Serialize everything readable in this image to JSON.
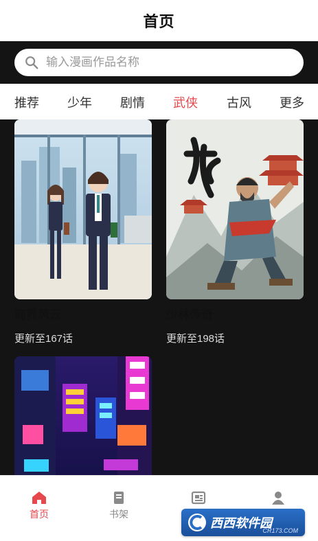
{
  "header": {
    "title": "首页"
  },
  "search": {
    "placeholder": "输入漫画作品名称",
    "icon": "search-icon"
  },
  "tabs": [
    {
      "label": "推荐",
      "active": false
    },
    {
      "label": "少年",
      "active": false
    },
    {
      "label": "剧情",
      "active": false
    },
    {
      "label": "武侠",
      "active": true
    },
    {
      "label": "古风",
      "active": false
    },
    {
      "label": "更多",
      "active": false
    }
  ],
  "comics": [
    {
      "title": "商界风云",
      "update": "更新至167话"
    },
    {
      "title": "少林传奇",
      "update": "更新至198话"
    },
    {
      "title": "",
      "update": ""
    }
  ],
  "bottom_nav": [
    {
      "label": "首页",
      "icon": "home-icon",
      "active": true
    },
    {
      "label": "书架",
      "icon": "book-icon",
      "active": false
    },
    {
      "label": "",
      "icon": "news-icon",
      "active": false
    },
    {
      "label": "",
      "icon": "user-icon",
      "active": false
    }
  ],
  "watermark": {
    "text": "西西软件园",
    "sub": "CR173.COM"
  },
  "colors": {
    "accent": "#e5484d",
    "background": "#141414",
    "surface": "#ffffff"
  }
}
